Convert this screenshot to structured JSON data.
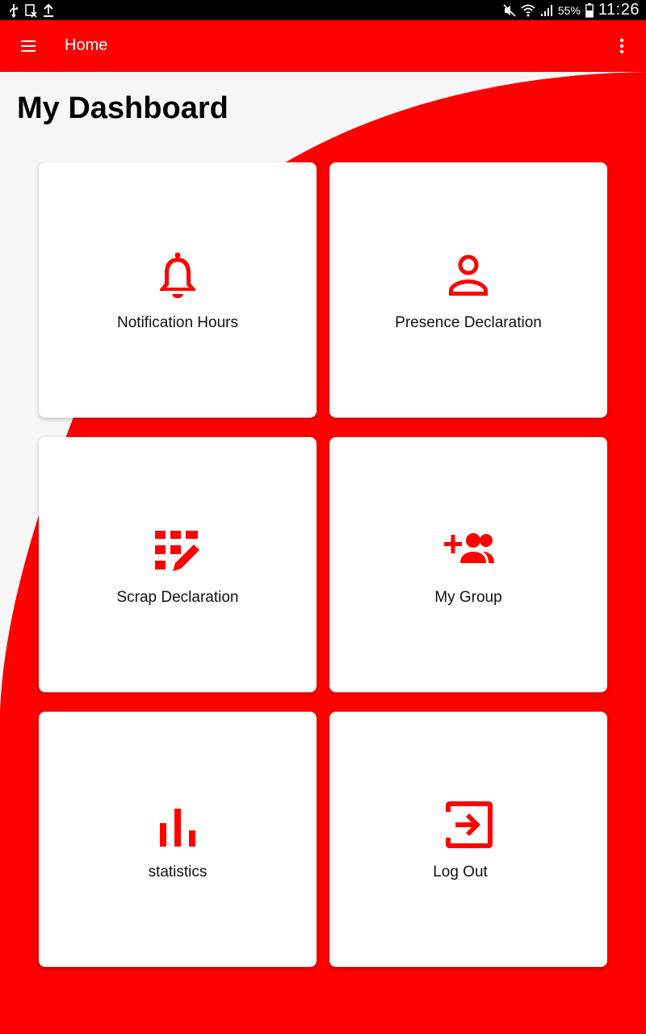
{
  "status_bar": {
    "battery_percent": "55%",
    "time": "11:26"
  },
  "app_bar": {
    "title": "Home"
  },
  "page": {
    "title": "My Dashboard"
  },
  "colors": {
    "brand": "#fe0000",
    "background_light": "#f7f7f7",
    "card": "#ffffff"
  },
  "cards": [
    {
      "label": "Notification Hours",
      "icon": "bell-icon"
    },
    {
      "label": "Presence Declaration",
      "icon": "person-icon"
    },
    {
      "label": "Scrap Declaration",
      "icon": "grid-edit-icon"
    },
    {
      "label": "My Group",
      "icon": "group-add-icon"
    },
    {
      "label": "statistics",
      "icon": "bar-chart-icon"
    },
    {
      "label": "Log Out",
      "icon": "exit-icon"
    }
  ]
}
